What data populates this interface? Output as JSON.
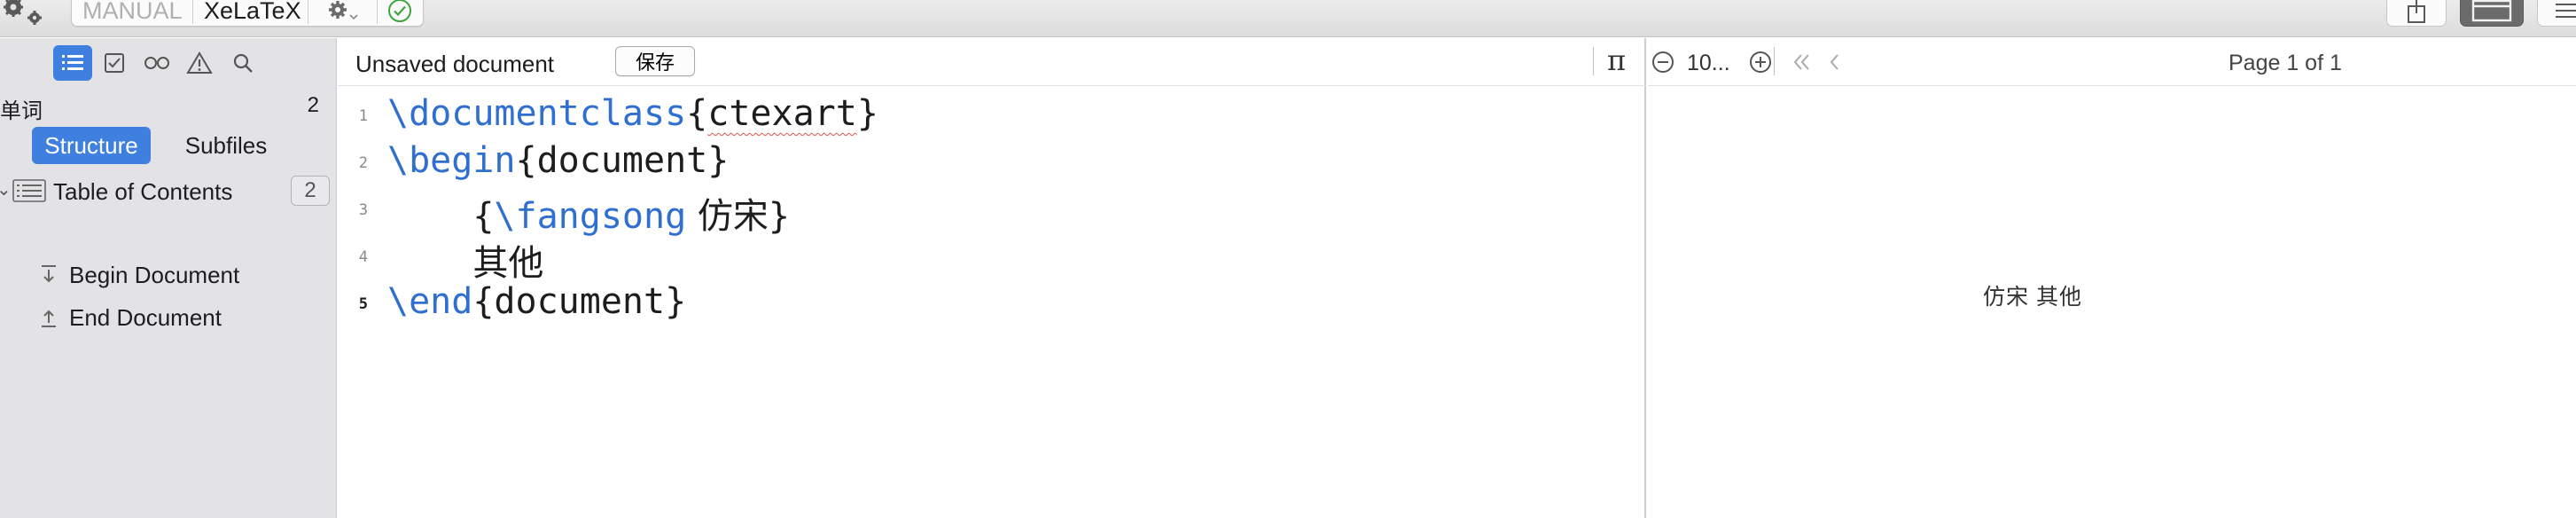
{
  "toolbar": {
    "typeset_mode": "MANUAL",
    "engine": "XeLaTeX",
    "icons": [
      "gears-icon",
      "gear-icon",
      "checkmark-circle-icon",
      "share-icon",
      "layout-icon",
      "menu-icon"
    ],
    "accent_color": "#3f7fe0",
    "check_color": "#3ca63c"
  },
  "sidebar": {
    "tabs": [
      {
        "icon": "outline-list-icon",
        "active": true
      },
      {
        "icon": "todo-checkbox-icon",
        "active": false
      },
      {
        "icon": "links-icon",
        "active": false
      },
      {
        "icon": "warning-icon",
        "active": false
      },
      {
        "icon": "search-icon",
        "active": false
      }
    ],
    "word_label": "单词",
    "word_count": "2",
    "segments": {
      "structure": "Structure",
      "subfiles": "Subfiles",
      "selected": "Structure"
    },
    "toc": {
      "label": "Table of Contents",
      "count": "2"
    },
    "items": [
      {
        "label": "Begin Document",
        "icon": "begin-document-icon"
      },
      {
        "label": "End Document",
        "icon": "end-document-icon"
      }
    ]
  },
  "editor": {
    "title": "Unsaved document",
    "save_label": "保存",
    "pi_label": "π",
    "active_line": 5,
    "lines": [
      {
        "number": "1",
        "cmd": "\\documentclass",
        "open": "{",
        "arg": "ctexart",
        "close": "}"
      },
      {
        "number": "2",
        "cmd": "\\begin",
        "open": "{",
        "arg": "document",
        "close": "}"
      },
      {
        "number": "3",
        "indent": "    ",
        "open": "{",
        "cmd": "\\fangsong",
        "arg": " 仿宋",
        "close": "}"
      },
      {
        "number": "4",
        "indent": "    ",
        "text": "其他"
      },
      {
        "number": "5",
        "cmd": "\\end",
        "open": "{",
        "arg": "document",
        "close": "}"
      }
    ]
  },
  "preview": {
    "zoom": "10...",
    "page_indicator": "Page 1 of 1",
    "rendered_text": "仿宋 其他"
  }
}
